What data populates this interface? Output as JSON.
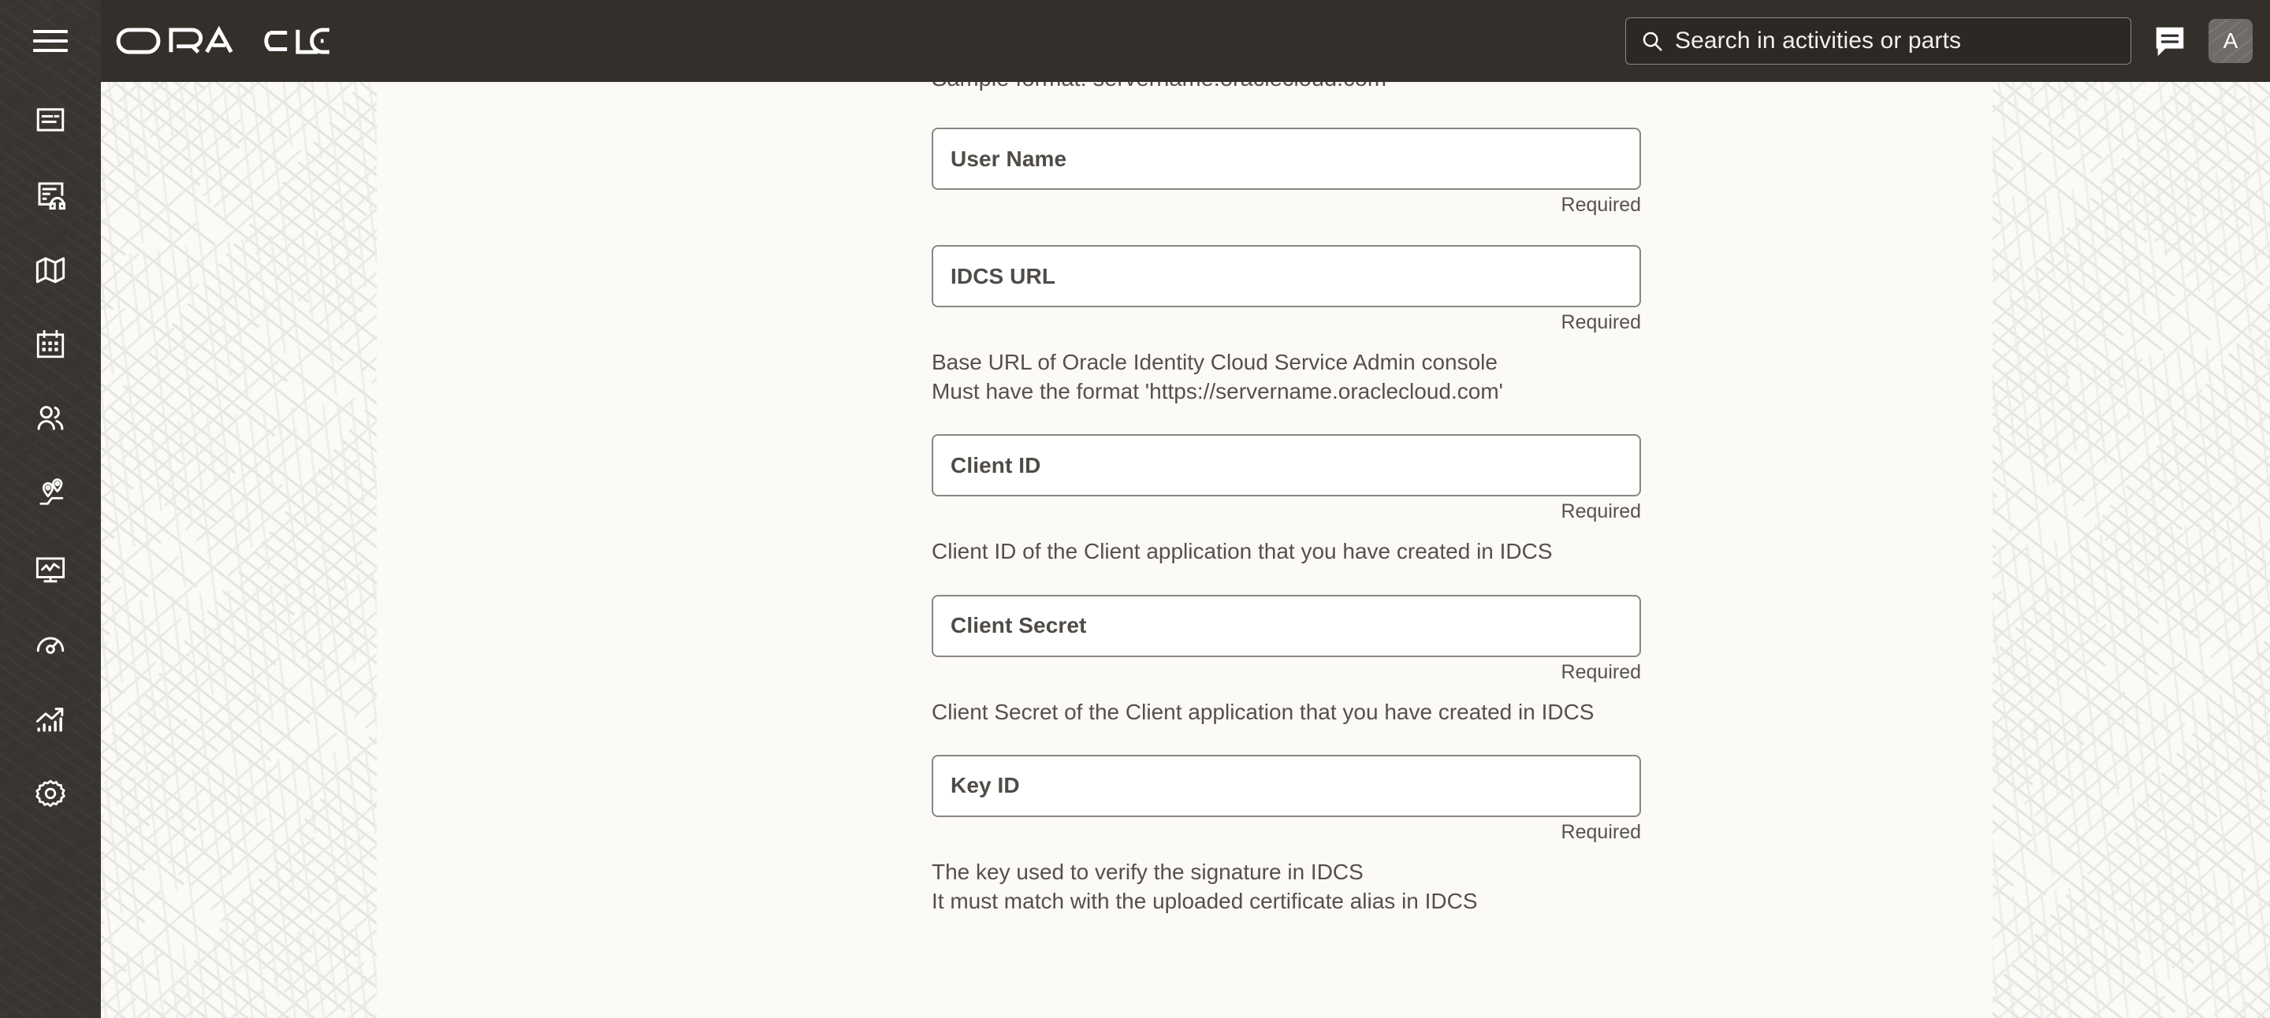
{
  "app": {
    "brand_name": "ORACLE",
    "menu_icon": "hamburger-menu-icon"
  },
  "sidebar": {
    "items": [
      {
        "icon": "document-list-icon",
        "label": "Activities"
      },
      {
        "icon": "document-headset-icon",
        "label": "Service Requests"
      },
      {
        "icon": "map-icon",
        "label": "Map"
      },
      {
        "icon": "calendar-icon",
        "label": "Calendar"
      },
      {
        "icon": "two-people-icon",
        "label": "Resources"
      },
      {
        "icon": "location-pins-route-icon",
        "label": "Routing"
      },
      {
        "icon": "monitor-activity-icon",
        "label": "Dispatch Console"
      },
      {
        "icon": "gauge-icon",
        "label": "Performance"
      },
      {
        "icon": "trend-bars-icon",
        "label": "Reports"
      },
      {
        "icon": "gear-icon",
        "label": "Configuration"
      }
    ]
  },
  "header": {
    "search": {
      "icon": "search-icon",
      "placeholder": "Search in activities or parts",
      "value": ""
    },
    "chat": {
      "icon": "chat-bubble-icon",
      "label": "Collaboration"
    },
    "avatar": {
      "initial": "A",
      "label": "User profile"
    }
  },
  "form": {
    "pre_text": "Sample format: servername.oraclecloud.com",
    "fields": [
      {
        "label": "User Name",
        "value": "",
        "required_text": "Required",
        "helper": []
      },
      {
        "label": "IDCS URL",
        "value": "",
        "required_text": "Required",
        "helper": [
          "Base URL of Oracle Identity Cloud Service Admin console",
          "Must have the format 'https://servername.oraclecloud.com'"
        ]
      },
      {
        "label": "Client ID",
        "value": "",
        "required_text": "Required",
        "helper": [
          "Client ID of the Client application that you have created in IDCS"
        ]
      },
      {
        "label": "Client Secret",
        "value": "",
        "required_text": "Required",
        "helper": [
          "Client Secret of the Client application that you have created in IDCS"
        ]
      },
      {
        "label": "Key ID",
        "value": "",
        "required_text": "Required",
        "helper": [
          "The key used to verify the signature in IDCS",
          "It must match with the uploaded certificate alias in IDCS"
        ]
      }
    ]
  },
  "colors": {
    "rail_bg": "#383430",
    "topbar_bg": "#332f2b",
    "page_bg": "#fbfaf7",
    "field_border": "#8a8681",
    "text": "#55504b"
  }
}
